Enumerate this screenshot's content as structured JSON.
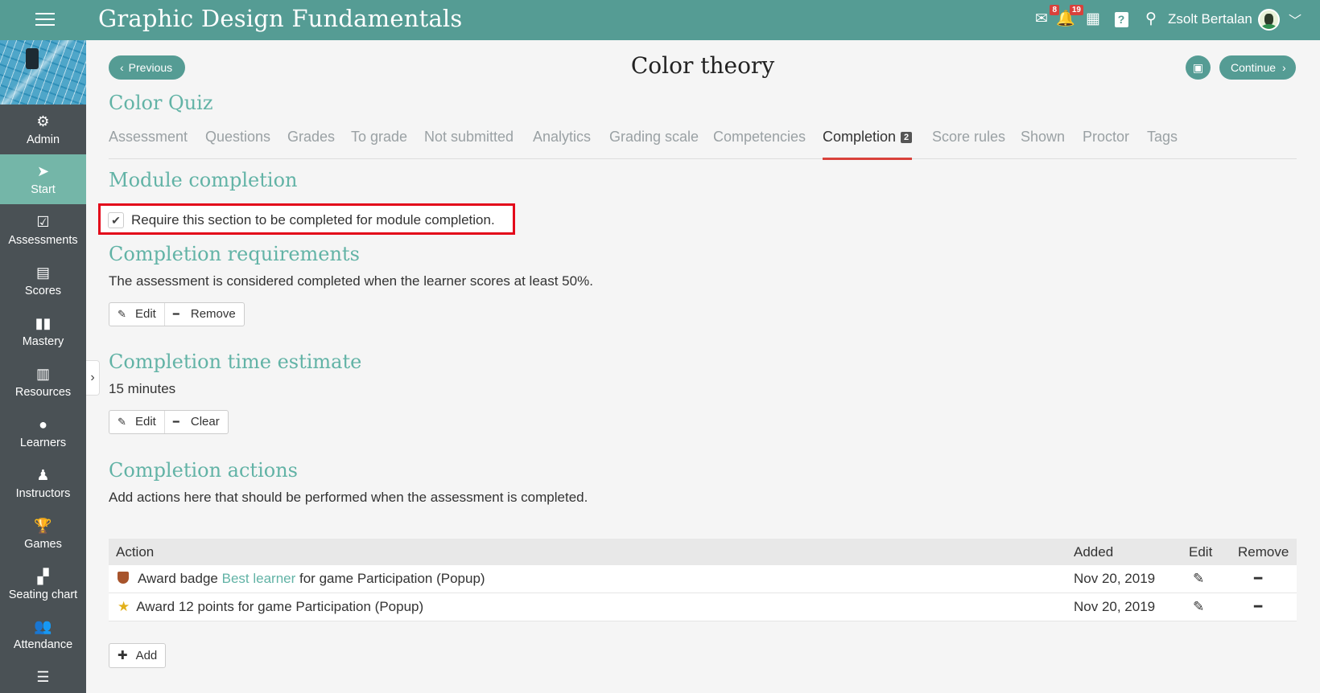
{
  "app": {
    "title": "Graphic Design Fundamentals",
    "user_name": "Zsolt Bertalan",
    "messages_count": "8",
    "notifications_count": "19"
  },
  "sidebar": {
    "items": [
      {
        "label": "Admin",
        "icon": "gear-icon"
      },
      {
        "label": "Start",
        "icon": "navigation-arrow-icon"
      },
      {
        "label": "Assessments",
        "icon": "checkbox-icon"
      },
      {
        "label": "Scores",
        "icon": "table-icon"
      },
      {
        "label": "Mastery",
        "icon": "bar-chart-icon"
      },
      {
        "label": "Resources",
        "icon": "books-icon"
      },
      {
        "label": "Learners",
        "icon": "person-icon"
      },
      {
        "label": "Instructors",
        "icon": "instructor-icon"
      },
      {
        "label": "Games",
        "icon": "trophy-icon"
      },
      {
        "label": "Seating chart",
        "icon": "seating-icon"
      },
      {
        "label": "Attendance",
        "icon": "group-icon"
      }
    ]
  },
  "nav": {
    "previous": "Previous",
    "continue": "Continue"
  },
  "page": {
    "title": "Color theory",
    "quiz_title": "Color Quiz"
  },
  "tabs": [
    {
      "label": "Assessment"
    },
    {
      "label": "Questions"
    },
    {
      "label": "Grades"
    },
    {
      "label": "To grade"
    },
    {
      "label": "Not submitted"
    },
    {
      "label": "Analytics"
    },
    {
      "label": "Grading scale"
    },
    {
      "label": "Competencies"
    },
    {
      "label": "Completion",
      "count": "2"
    },
    {
      "label": "Score rules"
    },
    {
      "label": "Shown"
    },
    {
      "label": "Proctor"
    },
    {
      "label": "Tags"
    }
  ],
  "module_completion": {
    "heading": "Module completion",
    "checkbox_label": "Require this section to be completed for module completion.",
    "checked": true
  },
  "requirements": {
    "heading": "Completion requirements",
    "text": "The assessment is considered completed when the learner scores at least 50%.",
    "edit_label": "Edit",
    "remove_label": "Remove"
  },
  "time_estimate": {
    "heading": "Completion time estimate",
    "value": "15 minutes",
    "edit_label": "Edit",
    "clear_label": "Clear"
  },
  "actions": {
    "heading": "Completion actions",
    "text": "Add actions here that should be performed when the assessment is completed.",
    "columns": {
      "action": "Action",
      "added": "Added",
      "edit": "Edit",
      "remove": "Remove"
    },
    "rows": [
      {
        "prefix": "Award badge ",
        "link": "Best learner",
        "suffix": " for game Participation (Popup)",
        "added": "Nov 20, 2019",
        "icon": "badge-shield-icon"
      },
      {
        "prefix": "Award 12 points for game Participation (Popup)",
        "link": "",
        "suffix": "",
        "added": "Nov 20, 2019",
        "icon": "star-icon"
      }
    ],
    "add_label": "Add"
  }
}
